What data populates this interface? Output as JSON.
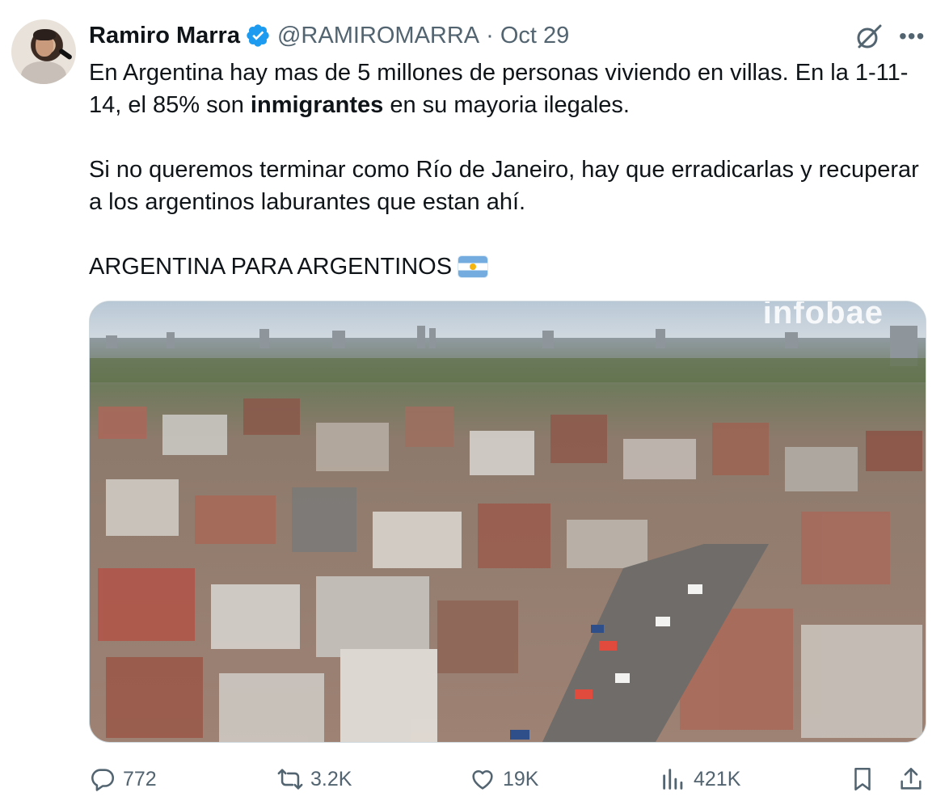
{
  "tweet": {
    "author_name": "Ramiro Marra",
    "handle": "@RAMIROMARRA",
    "separator": "·",
    "date": "Oct 29",
    "verified": true,
    "text": {
      "p1_a": "En Argentina hay mas de 5 millones de personas viviendo en villas. En la 1-11-14, el 85% son ",
      "p1_bold": "inmigrantes",
      "p1_b": " en su mayoria ilegales.",
      "p2": "Si no queremos terminar como Río de Janeiro, hay que erradicarlas y recuperar a los argentinos laburantes que estan ahí.",
      "p3": "ARGENTINA PARA ARGENTINOS"
    },
    "media": {
      "watermark": "infobae"
    }
  },
  "actions": {
    "replies": "772",
    "reposts": "3.2K",
    "likes": "19K",
    "views": "421K"
  },
  "icons": {
    "verified": "verified-badge-icon",
    "grok": "grok-icon",
    "more": "more-icon",
    "reply": "reply-icon",
    "repost": "repost-icon",
    "like": "heart-icon",
    "views": "views-icon",
    "bookmark": "bookmark-icon",
    "share": "share-icon"
  },
  "colors": {
    "text": "#0f1419",
    "muted": "#536471",
    "verified": "#1d9bf0",
    "border": "#cfd9de"
  }
}
